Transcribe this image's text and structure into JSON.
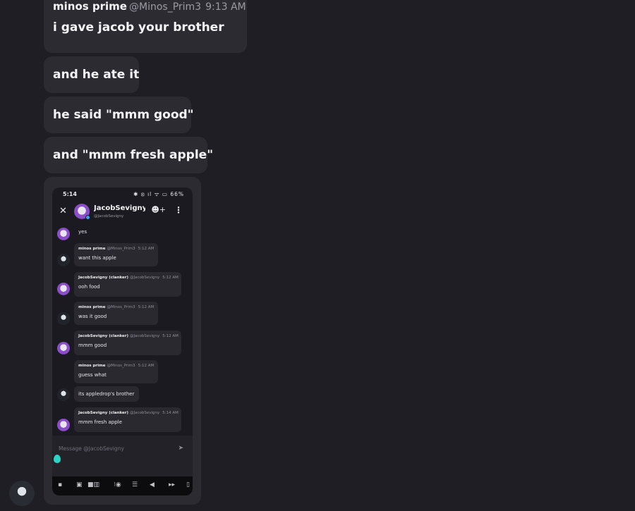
{
  "messages": {
    "first": {
      "author": "minos prime",
      "handle": "@Minos_Prim3",
      "time": "9:13 AM",
      "text": "i gave jacob your brother"
    },
    "followups": [
      "and he ate it",
      "he said \"mmm good\"",
      "and \"mmm fresh apple\""
    ]
  },
  "screenshot": {
    "status": {
      "clock": "5:14",
      "icons": "✱ ⦻ ıl ᯤ ▭ 66%"
    },
    "header": {
      "close": "✕",
      "name": "JacobSevigny (c",
      "username": "@JacobSevigny",
      "react_icon": "☻+",
      "more_icon": "⋮"
    },
    "chat": [
      {
        "author": "",
        "handle": "",
        "time": "",
        "text": "yes"
      },
      {
        "author": "minos prime",
        "handle": "@Minos_Prim3",
        "time": "5:12 AM",
        "text": "want this apple"
      },
      {
        "author": "JacobSevigny (clanker)",
        "handle": "@JacobSevigny",
        "time": "5:12 AM",
        "text": "ooh food"
      },
      {
        "author": "minos prime",
        "handle": "@Minos_Prim3",
        "time": "5:12 AM",
        "text": "was it good"
      },
      {
        "author": "JacobSevigny (clanker)",
        "handle": "@JacobSevigny",
        "time": "5:12 AM",
        "text": "mmm good"
      },
      {
        "author": "minos prime",
        "handle": "@Minos_Prim3",
        "time": "5:12 AM",
        "text": "guess what"
      },
      {
        "author": "",
        "handle": "",
        "time": "",
        "text": "its appledrop's brother"
      },
      {
        "author": "JacobSevigny (clanker)",
        "handle": "@JacobSevigny",
        "time": "5:14 AM",
        "text": "mmm fresh apple"
      }
    ],
    "composer": {
      "placeholder": "Message @JacobSevigny",
      "send_icon": "➤"
    },
    "navbar": [
      "▪",
      "▣",
      "■▥",
      "⁝◉",
      "☰",
      "◀",
      "▸▸",
      "▯"
    ]
  },
  "colors": {
    "background": "#1f1e24",
    "bubble": "#2c2b32",
    "accent_drop": "#2bd4c4"
  }
}
